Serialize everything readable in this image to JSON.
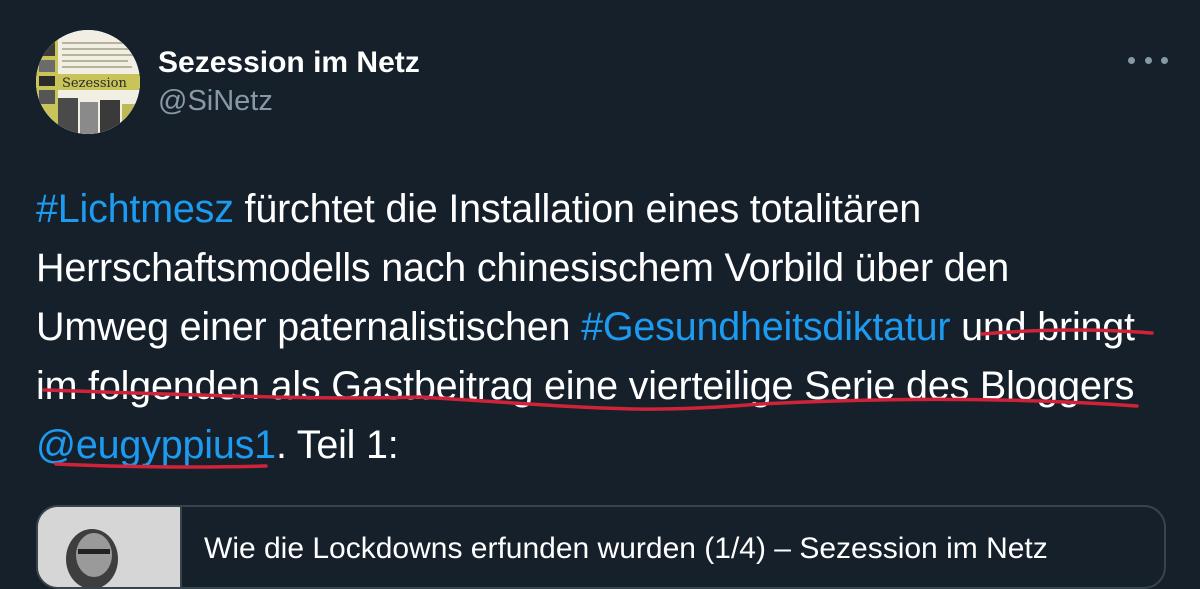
{
  "author": {
    "display_name": "Sezession im Netz",
    "handle": "@SiNetz",
    "avatar_label": "Sezession"
  },
  "tweet": {
    "lines": [
      [
        {
          "text": "#Lichtmesz",
          "type": "hashtag"
        },
        {
          "text": " fürchtet die Installation eines totalitären",
          "type": "text"
        }
      ],
      [
        {
          "text": "Herrschaftsmodells nach chinesischem Vorbild über den",
          "type": "text"
        }
      ],
      [
        {
          "text": "Umweg einer paternalistischen ",
          "type": "text"
        },
        {
          "text": "#Gesundheitsdiktatur",
          "type": "hashtag"
        },
        {
          "text": " und bringt",
          "type": "text"
        }
      ],
      [
        {
          "text": "im folgenden als Gastbeitrag eine vierteilige Serie des Bloggers",
          "type": "text"
        }
      ],
      [
        {
          "text": "@eugyppius1",
          "type": "mention"
        },
        {
          "text": ". Teil 1:",
          "type": "text"
        }
      ]
    ]
  },
  "link_card": {
    "title": "Wie die Lockdowns erfunden wurden (1/4) – Sezession im Netz"
  },
  "colors": {
    "background": "#15202b",
    "text": "#ffffff",
    "secondary": "#8899a6",
    "link": "#1d9bf0",
    "annotation": "#d0233a"
  },
  "icons": {
    "more": "more-horizontal-icon"
  }
}
